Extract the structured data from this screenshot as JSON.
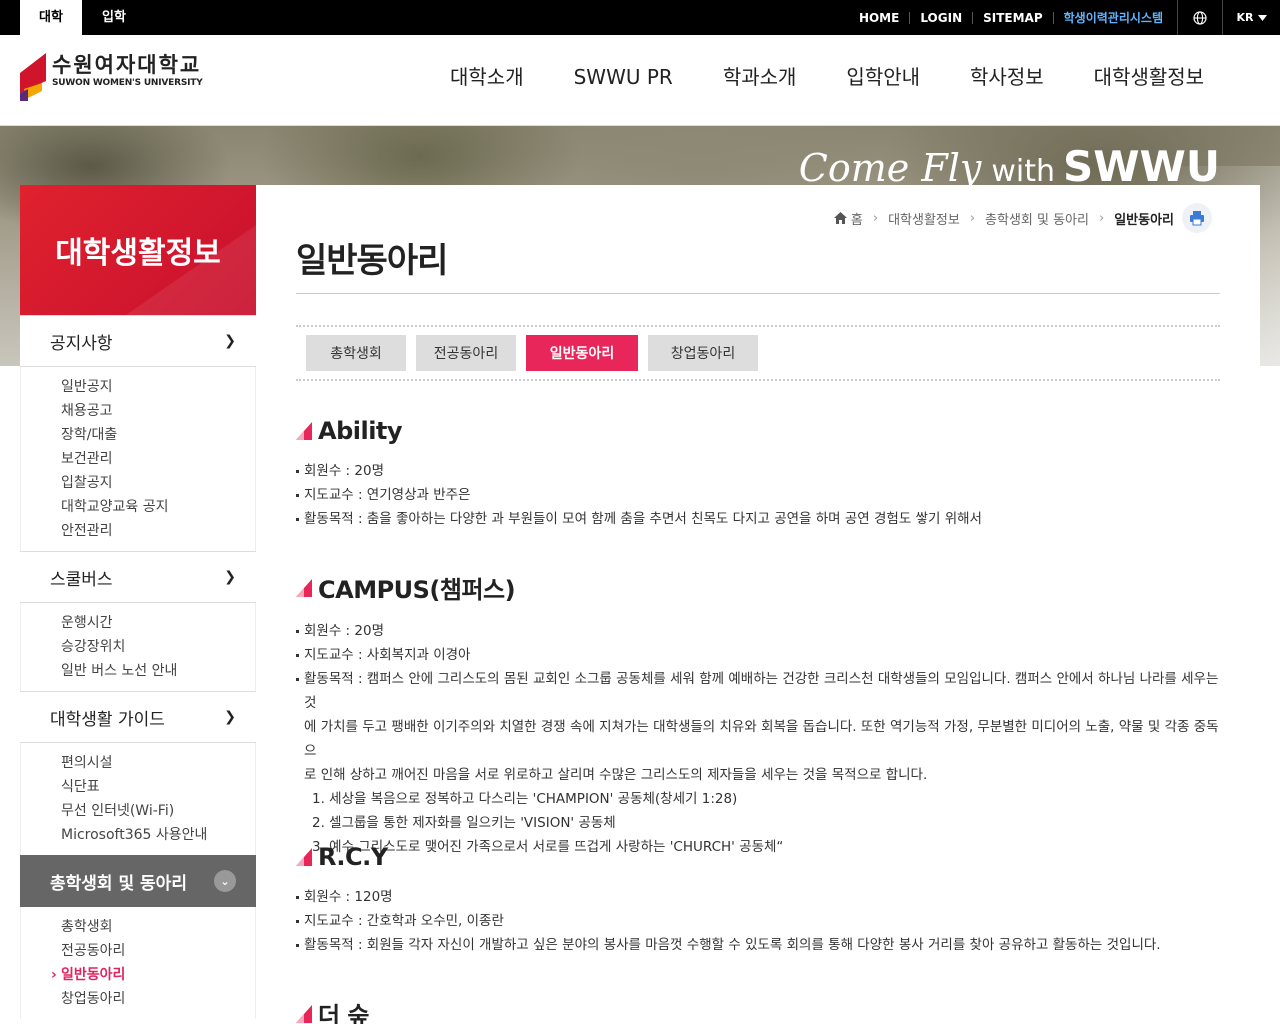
{
  "topbar": {
    "tabs": [
      "대학",
      "입학"
    ],
    "links": [
      "HOME",
      "LOGIN",
      "SITEMAP",
      "학생이력관리시스템"
    ],
    "lang": "KR"
  },
  "logo": {
    "ko": "수원여자대학교",
    "en": "SUWON WOMEN'S UNIVERSITY"
  },
  "gnb": [
    "대학소개",
    "SWWU PR",
    "학과소개",
    "입학안내",
    "학사정보",
    "대학생활정보"
  ],
  "hero": {
    "slogan_script": "Come Fly",
    "slogan_with": "with",
    "slogan_bold": "SWWU"
  },
  "lnb": {
    "title": "대학생활정보",
    "groups": [
      {
        "label": "공지사항",
        "items": [
          "일반공지",
          "채용공고",
          "장학/대출",
          "보건관리",
          "입찰공지",
          "대학교양교육 공지",
          "안전관리"
        ]
      },
      {
        "label": "스쿨버스",
        "items": [
          "운행시간",
          "승강장위치",
          "일반 버스 노선 안내"
        ]
      },
      {
        "label": "대학생활 가이드",
        "items": [
          "편의시설",
          "식단표",
          "무선 인터넷(Wi-Fi)",
          "Microsoft365 사용안내"
        ]
      },
      {
        "label": "총학생회 및 동아리",
        "items": [
          "총학생회",
          "전공동아리",
          "일반동아리",
          "창업동아리"
        ]
      }
    ]
  },
  "breadcrumb": [
    "홈",
    "대학생활정보",
    "총학생회 및 동아리",
    "일반동아리"
  ],
  "page_title": "일반동아리",
  "tabs": [
    "총학생회",
    "전공동아리",
    "일반동아리",
    "창업동아리"
  ],
  "clubs": [
    {
      "name": "Ability",
      "rows": [
        "회원수 : 20명",
        "지도교수 : 연기영상과 반주은",
        "활동목적 : 춤을 좋아하는 다양한 과 부원들이 모여 함께 춤을 추면서 친목도 다지고 공연을 하며 공연 경험도 쌓기 위해서"
      ]
    },
    {
      "name": "CAMPUS(챔퍼스)",
      "rows": [
        "회원수 : 20명",
        "지도교수 : 사회복지과 이경아"
      ],
      "purpose_lines": [
        "활동목적 : 캠퍼스 안에 그리스도의 몸된 교회인 소그룹 공동체를 세워 함께 예배하는 건강한 크리스천 대학생들의 모임입니다. 캠퍼스 안에서 하나님 나라를 세우는 것",
        "에 가치를 두고 팽배한 이기주의와 치열한 경쟁 속에 지쳐가는 대학생들의 치유와 회복을 돕습니다. 또한 역기능적 가정, 무분별한 미디어의 노출, 약물 및 각종 중독으",
        "로 인해 상하고 깨어진 마음을 서로 위로하고 살리며 수많은 그리스도의 제자들을 세우는 것을 목적으로 합니다."
      ],
      "list": [
        "1. 세상을 복음으로 정복하고 다스리는 'CHAMPION' 공동체(창세기 1:28)",
        "2. 셀그룹을 통한 제자화를 일으키는 'VISION' 공동체",
        "3. 예수 그리스도로 맺어진 가족으로서 서로를 뜨겁게 사랑하는 'CHURCH' 공동체“"
      ]
    },
    {
      "name": "R.C.Y",
      "rows": [
        "회원수 : 120명",
        "지도교수 : 간호학과 오수민, 이종란",
        "활동목적 : 회원들 각자 자신이 개발하고 싶은 분야의 봉사를 마음껏 수행할 수 있도록 회의를 통해 다양한 봉사 거리를 찾아 공유하고 활동하는 것입니다."
      ]
    },
    {
      "name": "더 숲"
    }
  ],
  "colors": {
    "accent": "#e8265a",
    "brand_red": "#d0142c",
    "top_bg": "#000000"
  }
}
